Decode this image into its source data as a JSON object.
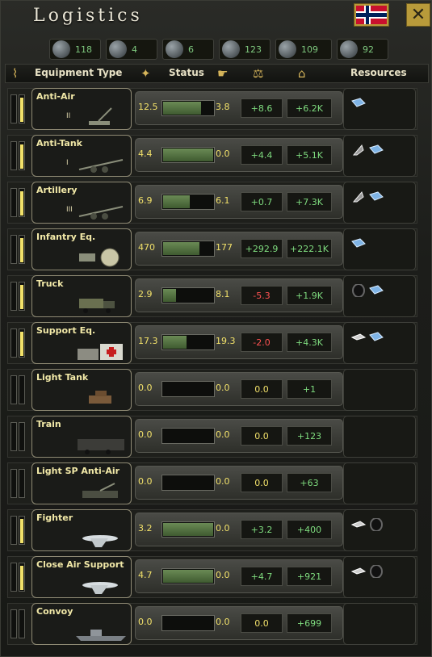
{
  "window": {
    "title": "Logistics"
  },
  "resources": [
    {
      "name": "oil",
      "icon": "oil-drop-icon",
      "value": "118"
    },
    {
      "name": "aluminium",
      "icon": "aluminium-icon",
      "value": "4"
    },
    {
      "name": "rubber",
      "icon": "rubber-icon",
      "value": "6"
    },
    {
      "name": "tungsten",
      "icon": "tungsten-icon",
      "value": "123"
    },
    {
      "name": "steel",
      "icon": "steel-icon",
      "value": "109"
    },
    {
      "name": "chromium",
      "icon": "chromium-icon",
      "value": "92"
    }
  ],
  "header": {
    "equipment_type": "Equipment Type",
    "status": "Status",
    "resources": "Resources"
  },
  "colors": {
    "positive": "#7fdc7f",
    "negative": "#ff5252",
    "value": "#f2e16a",
    "accent": "#b89a3a"
  },
  "rows": [
    {
      "name": "Anti-Air",
      "level": "II",
      "pic": "anti-air-gun",
      "a": "12.5",
      "b": "3.8",
      "diff": "+8.6",
      "total": "+6.2K",
      "diffColor": "green",
      "fill": 0.75,
      "res": [
        "steel"
      ]
    },
    {
      "name": "Anti-Tank",
      "level": "I",
      "pic": "anti-tank-gun",
      "a": "4.4",
      "b": "0.0",
      "diff": "+4.4",
      "total": "+5.1K",
      "diffColor": "green",
      "fill": 1.0,
      "res": [
        "tungsten",
        "steel"
      ]
    },
    {
      "name": "Artillery",
      "level": "III",
      "pic": "artillery",
      "a": "6.9",
      "b": "6.1",
      "diff": "+0.7",
      "total": "+7.3K",
      "diffColor": "green",
      "fill": 0.53,
      "res": [
        "tungsten",
        "steel"
      ]
    },
    {
      "name": "Infantry Eq.",
      "level": "",
      "pic": "machine-gun",
      "a": "470",
      "b": "177",
      "diff": "+292.9",
      "total": "+222.1K",
      "diffColor": "green",
      "fill": 0.73,
      "res": [
        "steel"
      ]
    },
    {
      "name": "Truck",
      "level": "",
      "pic": "truck",
      "a": "2.9",
      "b": "8.1",
      "diff": "-5.3",
      "total": "+1.9K",
      "diffColor": "red",
      "fill": 0.26,
      "res": [
        "rubber",
        "steel"
      ]
    },
    {
      "name": "Support Eq.",
      "level": "",
      "pic": "medical-supplies",
      "a": "17.3",
      "b": "19.3",
      "diff": "-2.0",
      "total": "+4.3K",
      "diffColor": "red",
      "fill": 0.47,
      "res": [
        "aluminium",
        "steel"
      ]
    },
    {
      "name": "Light Tank",
      "level": "",
      "pic": "light-tank",
      "a": "0.0",
      "b": "0.0",
      "diff": "0.0",
      "total": "+1",
      "diffColor": "yellow",
      "fill": 0.0,
      "res": []
    },
    {
      "name": "Train",
      "level": "",
      "pic": "train",
      "a": "0.0",
      "b": "0.0",
      "diff": "0.0",
      "total": "+123",
      "diffColor": "yellow",
      "fill": 0.0,
      "res": []
    },
    {
      "name": "Light SP Anti-Air",
      "level": "",
      "pic": "sp-anti-air",
      "a": "0.0",
      "b": "0.0",
      "diff": "0.0",
      "total": "+63",
      "diffColor": "yellow",
      "fill": 0.0,
      "res": []
    },
    {
      "name": "Fighter",
      "level": "",
      "pic": "fighter",
      "a": "3.2",
      "b": "0.0",
      "diff": "+3.2",
      "total": "+400",
      "diffColor": "green",
      "fill": 1.0,
      "res": [
        "aluminium",
        "rubber"
      ]
    },
    {
      "name": "Close Air Support",
      "level": "",
      "pic": "cas",
      "a": "4.7",
      "b": "0.0",
      "diff": "+4.7",
      "total": "+921",
      "diffColor": "green",
      "fill": 1.0,
      "res": [
        "aluminium",
        "rubber"
      ]
    },
    {
      "name": "Convoy",
      "level": "",
      "pic": "convoy",
      "a": "0.0",
      "b": "0.0",
      "diff": "0.0",
      "total": "+699",
      "diffColor": "yellow",
      "fill": 0.0,
      "res": []
    }
  ]
}
